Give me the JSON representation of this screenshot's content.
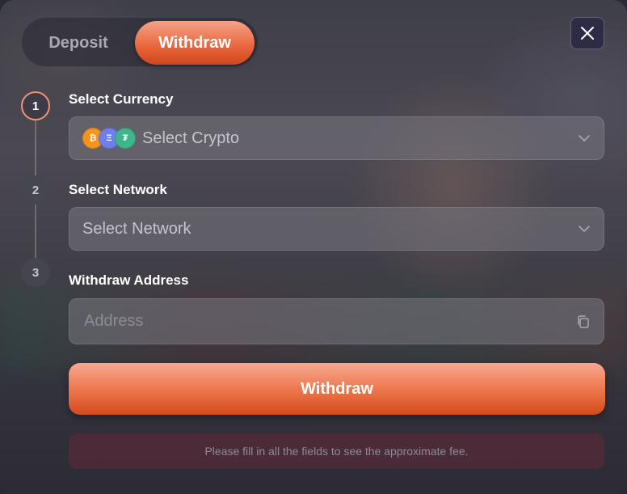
{
  "tabs": {
    "deposit": "Deposit",
    "withdraw": "Withdraw",
    "active": "Withdraw"
  },
  "close": {
    "icon": "close-icon"
  },
  "steps": [
    {
      "number": "1",
      "label": "Select Currency",
      "state": "active"
    },
    {
      "number": "2",
      "label": "Select Network",
      "state": "inactive"
    },
    {
      "number": "3",
      "label": "Withdraw Address",
      "state": "inactive"
    }
  ],
  "currency": {
    "value": "Select Crypto",
    "coins": [
      {
        "icon": "bitcoin-icon",
        "glyph": "₿",
        "color": "#f7931a"
      },
      {
        "icon": "ethereum-icon",
        "glyph": "Ξ",
        "color": "#6f7ee8"
      },
      {
        "icon": "tether-icon",
        "glyph": "₮",
        "color": "#3fb58c"
      }
    ],
    "icon": "chevron-down-icon"
  },
  "network": {
    "value": "Select Network",
    "icon": "chevron-down-icon"
  },
  "address": {
    "placeholder": "Address",
    "value": "",
    "icon": "copy-icon"
  },
  "submit": {
    "label": "Withdraw"
  },
  "fee_note": "Please fill in all the fields to see the approximate fee.",
  "colors": {
    "accent": "#e8643a",
    "accent_light": "#f4a489",
    "modal_bg": "#4a4a55"
  }
}
